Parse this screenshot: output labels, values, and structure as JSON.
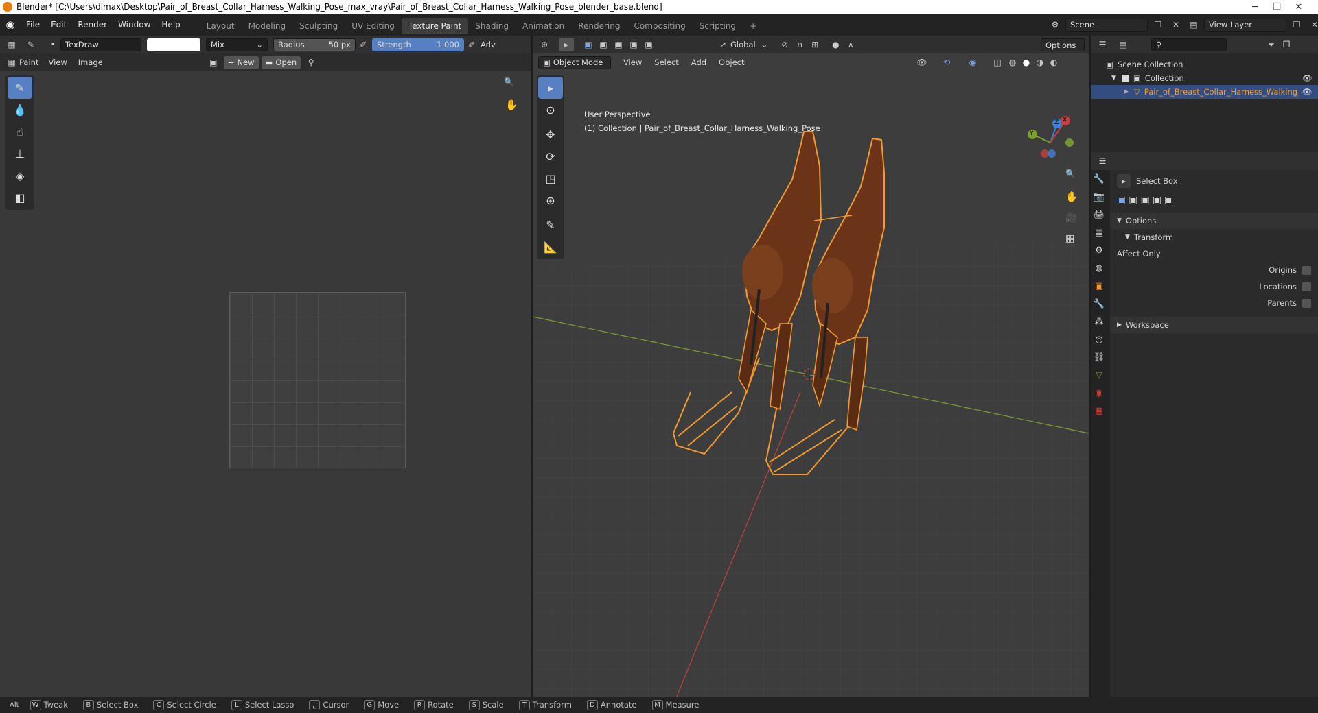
{
  "window": {
    "title": "Blender* [C:\\Users\\dimax\\Desktop\\Pair_of_Breast_Collar_Harness_Walking_Pose_max_vray\\Pair_of_Breast_Collar_Harness_Walking_Pose_blender_base.blend]",
    "minimize": "─",
    "maximize": "❐",
    "close": "✕"
  },
  "menu": [
    "File",
    "Edit",
    "Render",
    "Window",
    "Help"
  ],
  "workspaces": [
    "Layout",
    "Modeling",
    "Sculpting",
    "UV Editing",
    "Texture Paint",
    "Shading",
    "Animation",
    "Rendering",
    "Compositing",
    "Scripting"
  ],
  "workspace_add": "+",
  "scene": {
    "label": "Scene",
    "view_layer": "View Layer"
  },
  "paint_header": {
    "brush": "TexDraw",
    "blend": "Mix",
    "radius_label": "Radius",
    "radius_value": "50 px",
    "strength_label": "Strength",
    "strength_value": "1.000",
    "adv": "Adv"
  },
  "image_header": {
    "mode": "Paint",
    "view": "View",
    "image": "Image",
    "new": "New",
    "open": "Open"
  },
  "viewport_header": {
    "orientation": "Global",
    "options": "Options",
    "mode": "Object Mode",
    "view": "View",
    "select": "Select",
    "add": "Add",
    "object": "Object"
  },
  "viewport": {
    "perspective": "User Perspective",
    "collection_info": "(1) Collection | Pair_of_Breast_Collar_Harness_Walking_Pose",
    "gizmo": {
      "x": "X",
      "y": "Y",
      "z": "Z"
    }
  },
  "outliner": {
    "scene_collection": "Scene Collection",
    "collection": "Collection",
    "object": "Pair_of_Breast_Collar_Harness_Walking_Pose"
  },
  "properties": {
    "tool_name": "Select Box",
    "options": "Options",
    "transform": "Transform",
    "affect_only": "Affect Only",
    "origins": "Origins",
    "locations": "Locations",
    "parents": "Parents",
    "workspace": "Workspace"
  },
  "statusbar": [
    {
      "key": "Alt",
      "label": ""
    },
    {
      "key": "W",
      "label": "Tweak"
    },
    {
      "key": "B",
      "label": "Select Box"
    },
    {
      "key": "C",
      "label": "Select Circle"
    },
    {
      "key": "L",
      "label": "Select Lasso"
    },
    {
      "key": "␣",
      "label": "Cursor"
    },
    {
      "key": "G",
      "label": "Move"
    },
    {
      "key": "R",
      "label": "Rotate"
    },
    {
      "key": "S",
      "label": "Scale"
    },
    {
      "key": "T",
      "label": "Transform"
    },
    {
      "key": "D",
      "label": "Annotate"
    },
    {
      "key": "M",
      "label": "Measure"
    }
  ],
  "colors": {
    "accent": "#5680c2",
    "selection": "#f29a2e",
    "x_axis": "#c2413f",
    "y_axis": "#7aa02f",
    "horse": "#6b3418"
  }
}
